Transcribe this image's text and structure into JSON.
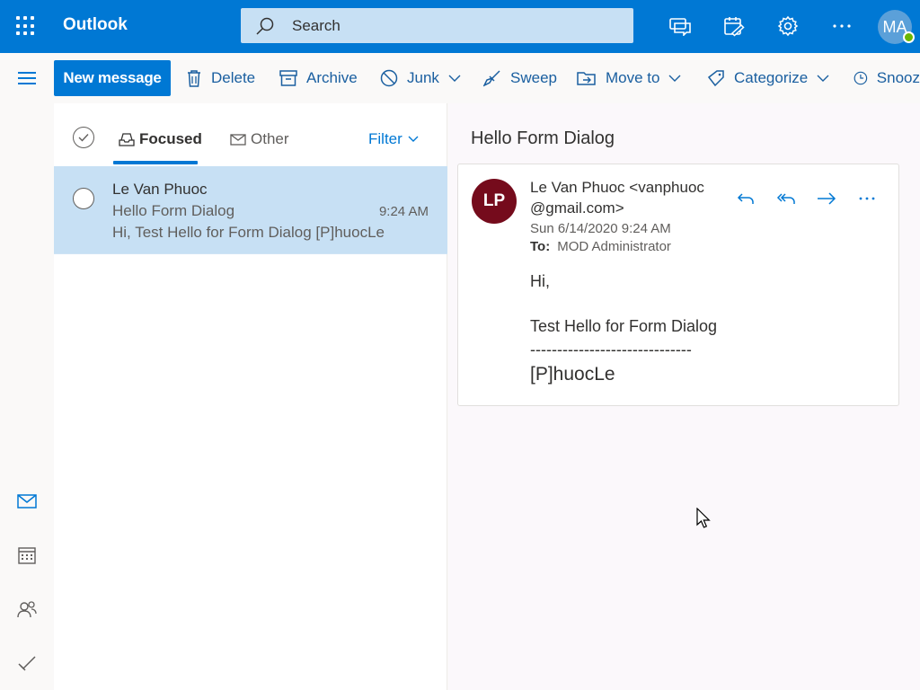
{
  "app": {
    "brand": "Outlook"
  },
  "header": {
    "search_placeholder": "Search",
    "user_initials": "MA",
    "icons": [
      "app-launcher-icon",
      "chat-feedback-icon",
      "my-day-icon",
      "settings-gear-icon",
      "more-icon"
    ]
  },
  "toolbar": {
    "new_message": "New message",
    "delete": "Delete",
    "archive": "Archive",
    "junk": "Junk",
    "sweep": "Sweep",
    "move_to": "Move to",
    "categorize": "Categorize",
    "snooze": "Snooz"
  },
  "list": {
    "tabs": {
      "focused": "Focused",
      "other": "Other"
    },
    "filter": "Filter",
    "messages": [
      {
        "sender": "Le Van Phuoc",
        "subject": "Hello Form Dialog",
        "time": "9:24 AM",
        "preview": "Hi, Test Hello for Form Dialog [P]huocLe"
      }
    ]
  },
  "reading": {
    "subject": "Hello Form Dialog",
    "sender_initials": "LP",
    "from_line1": "Le Van Phuoc <vanphuoc",
    "from_line2": "@gmail.com>",
    "date": "Sun 6/14/2020 9:24 AM",
    "to_label": "To:",
    "to_value": "MOD Administrator",
    "body": {
      "greeting": "Hi,",
      "line": "Test Hello for Form Dialog",
      "divider": "------------------------------",
      "signature": "[P]huocLe"
    }
  },
  "colors": {
    "brand": "#0078d4",
    "selected_row": "#c7e0f4",
    "avatar_lp": "#750b1c",
    "presence": "#6bb700"
  }
}
